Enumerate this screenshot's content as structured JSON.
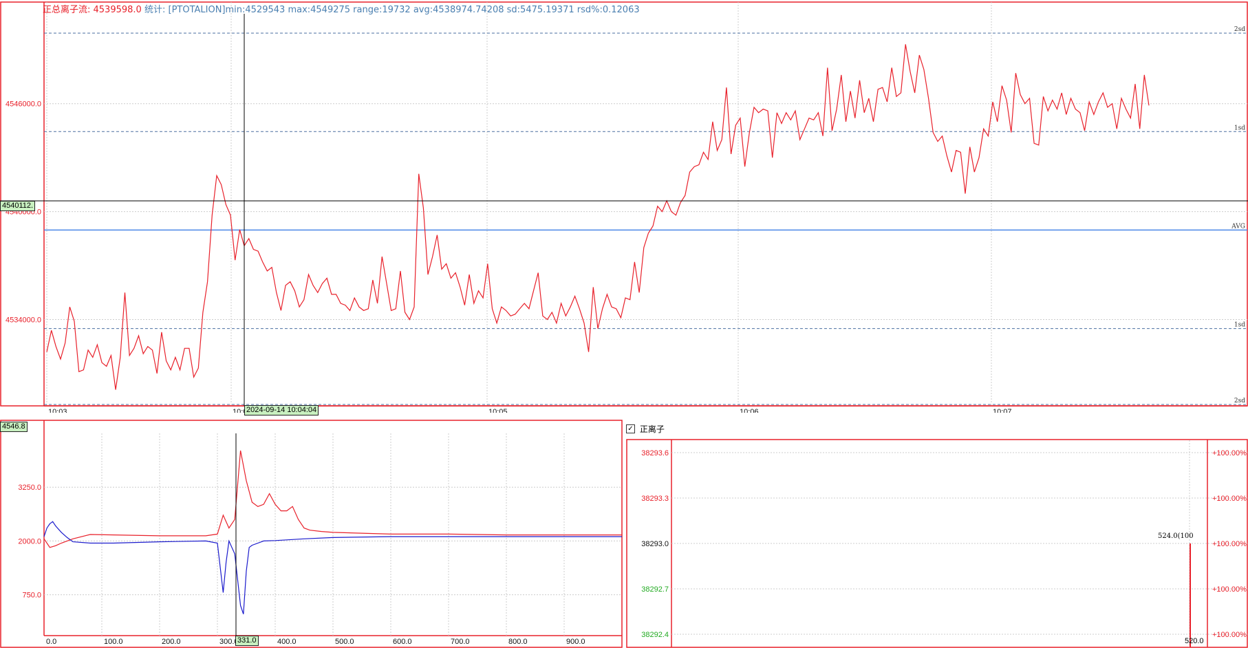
{
  "header": {
    "title": "正总离子流: 4539598.0",
    "stats_prefix": "统计:",
    "stats": "[PTOTALION]min:4529543 max:4549275 range:19732 avg:4538974.74208 sd:5475.19371 rsd%:0.12063"
  },
  "main_chart": {
    "y_labels": [
      "4546000.0",
      "4540000.0",
      "4534000.0"
    ],
    "x_labels": [
      "10:03",
      "10:04",
      "10:05",
      "10:06",
      "10:07"
    ],
    "sd_labels": [
      "2sd",
      "1sd",
      "AVG",
      "1sd",
      "2sd"
    ],
    "crosshair_value": "4540112.",
    "crosshair_time": "2024-09-14 10:04:04",
    "colors": {
      "line": "#e8202a",
      "avg": "#4a86e8",
      "sd": "#4a6fa0"
    }
  },
  "chart_data": [
    {
      "type": "line",
      "series": [
        {
          "name": "PTOTALION",
          "values": [
            4532200,
            4533400,
            4532500,
            4531800,
            4532700,
            4534700,
            4533900,
            4531100,
            4531200,
            4532300,
            4531900,
            4532600,
            4531600,
            4531400,
            4532000,
            4530100,
            4531900,
            4535500,
            4532000,
            4532400,
            4533100,
            4532100,
            4532500,
            4532300,
            4531000,
            4533300,
            4531700,
            4531200,
            4531900,
            4531200,
            4532400,
            4532400,
            4530800,
            4531300,
            4534400,
            4536100,
            4539800,
            4542000,
            4541500,
            4540400,
            4539800,
            4537300,
            4539000,
            4538100,
            4538500,
            4537900,
            4537800,
            4537200,
            4536700,
            4536900,
            4535500,
            4534500,
            4535900,
            4536100,
            4535600,
            4534700,
            4535100,
            4536500,
            4535900,
            4535500,
            4536000,
            4536300,
            4535400,
            4535400,
            4534900,
            4534800,
            4534500,
            4535200,
            4534700,
            4534500,
            4534600,
            4536200,
            4534900,
            4537500,
            4536000,
            4534500,
            4534600,
            4536700,
            4534400,
            4534000,
            4534700,
            4542100,
            4540200,
            4536500,
            4537500,
            4538700,
            4536800,
            4537100,
            4536300,
            4536600,
            4535800,
            4534800,
            4536500,
            4534900,
            4535600,
            4535200,
            4537100,
            4534600,
            4533800,
            4534700,
            4534500,
            4534200,
            4534300,
            4534600,
            4534900,
            4534600,
            4535600,
            4536600,
            4534200,
            4534000,
            4534400,
            4533800,
            4534900,
            4534200,
            4534700,
            4535300,
            4534600,
            4533800,
            4532200,
            4535800,
            4533500,
            4534600,
            4535400,
            4534700,
            4534600,
            4534100,
            4535200,
            4535100,
            4537200,
            4535500,
            4538000,
            4538800,
            4539200,
            4540300,
            4540000,
            4540600,
            4540000,
            4539800,
            4540500,
            4540900,
            4542200,
            4542500,
            4542600,
            4543300,
            4542900,
            4545000,
            4543400,
            4544000,
            4546900,
            4543200,
            4544800,
            4545200,
            4542500,
            4544400,
            4545800,
            4545500,
            4545700,
            4545600,
            4543000,
            4545500,
            4544900,
            4545500,
            4545100,
            4545600,
            4544000,
            4544600,
            4545200,
            4545100,
            4545500,
            4544200,
            4548000,
            4544500,
            4545700,
            4547600,
            4545000,
            4546700,
            4545200,
            4547300,
            4545500,
            4546300,
            4545000,
            4546800,
            4546900,
            4546100,
            4548000,
            4546400,
            4546600,
            4549300,
            4547800,
            4546600,
            4548700,
            4547900,
            4546300,
            4544400,
            4543900,
            4544200,
            4543100,
            4542200,
            4543400,
            4543300,
            4541000,
            4543600,
            4542200,
            4543000,
            4544600,
            4544200,
            4546100,
            4545000,
            4547000,
            4546200,
            4544400,
            4547700,
            4546500,
            4546000,
            4546300,
            4543800,
            4543700,
            4546400,
            4545600,
            4546200,
            4545700,
            4546600,
            4545400,
            4546300,
            4545700,
            4545500,
            4544500,
            4546100,
            4545400,
            4546100,
            4546600,
            4545800,
            4546000,
            4544600,
            4546300,
            4545700,
            4545200,
            4547100,
            4544600,
            4547600,
            4545900
          ],
          "color": "#e8202a"
        }
      ],
      "x_range": [
        "10:03",
        "10:07:30"
      ],
      "ylim": [
        4529200,
        4551000
      ],
      "reference_lines": {
        "avg": 4538974.74,
        "plus_1sd": 4544449.9,
        "plus_2sd": 4549925.1,
        "minus_1sd": 4533499.5,
        "minus_2sd": 4528024.4
      },
      "grid": true
    },
    {
      "type": "line",
      "x_labels": [
        "0.0",
        "100.0",
        "200.0",
        "300.0",
        "400.0",
        "500.0",
        "600.0",
        "700.0",
        "800.0",
        "900.0"
      ],
      "y_labels": [
        "3250.0",
        "2000.0",
        "750.0"
      ],
      "xlim": [
        0,
        1000
      ],
      "ylim": [
        -200,
        4500
      ],
      "series": [
        {
          "color": "#e8202a",
          "x": [
            0,
            5,
            10,
            20,
            30,
            50,
            80,
            120,
            200,
            280,
            300,
            310,
            320,
            330,
            340,
            350,
            360,
            370,
            380,
            390,
            400,
            410,
            420,
            430,
            440,
            450,
            460,
            480,
            500,
            600,
            700,
            800,
            900,
            1000
          ],
          "y": [
            2050,
            1950,
            1850,
            1890,
            1950,
            2050,
            2150,
            2140,
            2120,
            2120,
            2160,
            2600,
            2300,
            2500,
            4100,
            3400,
            2900,
            2800,
            2850,
            3100,
            2850,
            2700,
            2700,
            2800,
            2500,
            2300,
            2250,
            2220,
            2200,
            2160,
            2160,
            2140,
            2140,
            2140
          ]
        },
        {
          "color": "#1a1acc",
          "x": [
            0,
            5,
            10,
            15,
            20,
            30,
            40,
            50,
            80,
            120,
            200,
            280,
            300,
            310,
            315,
            320,
            330,
            340,
            345,
            350,
            355,
            360,
            380,
            400,
            450,
            500,
            600,
            700,
            800,
            900,
            1000
          ],
          "y": [
            2100,
            2300,
            2400,
            2450,
            2350,
            2200,
            2080,
            1980,
            1950,
            1950,
            1980,
            2000,
            1950,
            800,
            1500,
            2000,
            1700,
            500,
            300,
            1300,
            1850,
            1900,
            2000,
            2010,
            2050,
            2080,
            2100,
            2100,
            2100,
            2100,
            2100
          ]
        }
      ],
      "crosshair_value": "4546.8",
      "crosshair_x": "331.0"
    },
    {
      "type": "bar",
      "title": "正离子",
      "checked": true,
      "y_labels": [
        "38293.6",
        "38293.3",
        "38293.0",
        "38292.7",
        "38292.4"
      ],
      "y_label_colors": [
        "#e8202a",
        "#e8202a",
        "#111111",
        "#22aa22",
        "#22aa22"
      ],
      "right_labels": [
        "+100.00%",
        "+100.00%",
        "+100.00%",
        "+100.00%",
        "+100.00%"
      ],
      "bar_label": "524.0(100",
      "x_label": "520.0",
      "bars": [
        {
          "x": 524.0,
          "y": 38293.0,
          "percent": 100
        }
      ]
    }
  ]
}
